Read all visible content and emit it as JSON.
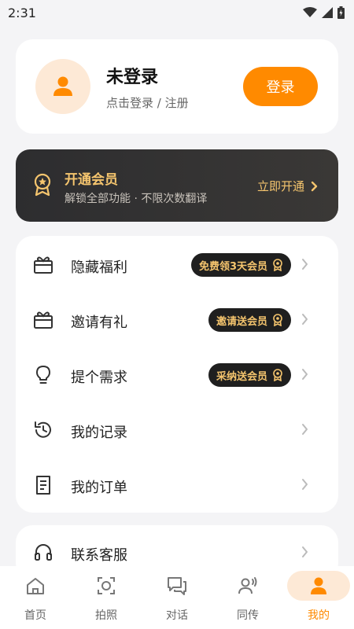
{
  "status_bar": {
    "time": "2:31"
  },
  "profile": {
    "name": "未登录",
    "subtitle": "点击登录 / 注册",
    "login_label": "登录"
  },
  "vip": {
    "title": "开通会员",
    "subtitle": "解锁全部功能 · 不限次数翻译",
    "cta": "立即开通"
  },
  "menu": [
    {
      "label": "隐藏福利",
      "icon": "gift-box-icon",
      "badge": "免费领3天会员"
    },
    {
      "label": "邀请有礼",
      "icon": "gift-box-icon",
      "badge": "邀请送会员"
    },
    {
      "label": "提个需求",
      "icon": "lightbulb-icon",
      "badge": "采纳送会员"
    },
    {
      "label": "我的记录",
      "icon": "history-icon",
      "badge": ""
    },
    {
      "label": "我的订单",
      "icon": "receipt-icon",
      "badge": ""
    }
  ],
  "support": {
    "label": "联系客服",
    "icon": "headset-icon"
  },
  "tabs": [
    {
      "label": "首页",
      "icon": "home-icon",
      "active": false
    },
    {
      "label": "拍照",
      "icon": "camera-scan-icon",
      "active": false
    },
    {
      "label": "对话",
      "icon": "chat-icon",
      "active": false
    },
    {
      "label": "同传",
      "icon": "voice-user-icon",
      "active": false
    },
    {
      "label": "我的",
      "icon": "person-icon",
      "active": true
    }
  ],
  "colors": {
    "accent": "#ff8a00",
    "accent_soft": "#fde9d6",
    "gold": "#f5c56e",
    "dark_card": "#2d2d2f"
  }
}
